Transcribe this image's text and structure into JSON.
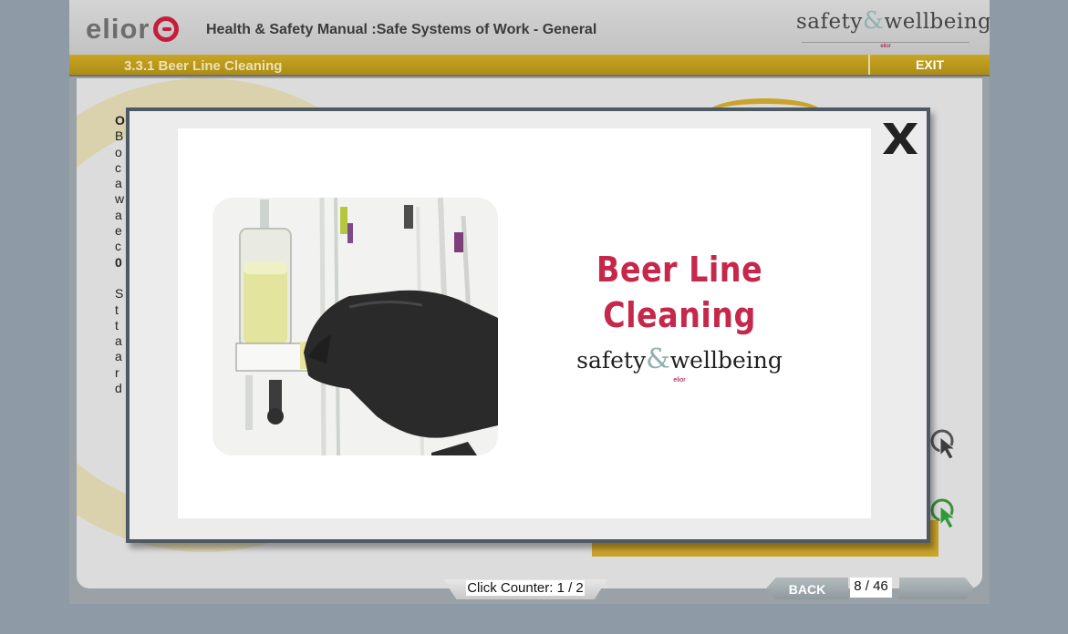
{
  "header": {
    "logo_text": "elior",
    "title": "Health & Safety Manual :Safe Systems of Work - General",
    "brand_pre": "safety",
    "brand_amp": "&",
    "brand_post": "wellbeing",
    "brand_small": "elior"
  },
  "titlebar": {
    "section_title": "3.3.1 Beer Line Cleaning",
    "exit_label": "EXIT"
  },
  "background": {
    "lines": [
      "O",
      "B",
      "o",
      "c",
      "a",
      "w",
      "a",
      "e",
      "c",
      "0",
      "",
      "S",
      "t",
      "t",
      "a",
      "a",
      "r",
      "d"
    ]
  },
  "footer": {
    "counter": "Click Counter: 1 / 2",
    "back_label": "BACK",
    "page_indicator": "8 / 46"
  },
  "modal": {
    "close_label": "X",
    "slide_title": "Beer Line Cleaning",
    "brand_pre": "safety",
    "brand_amp": "&",
    "brand_post": "wellbeing",
    "brand_small": "elior"
  },
  "colors": {
    "accent_gold": "#c9a32a",
    "brand_red": "#c5284b",
    "modal_border": "#4e5a63"
  }
}
